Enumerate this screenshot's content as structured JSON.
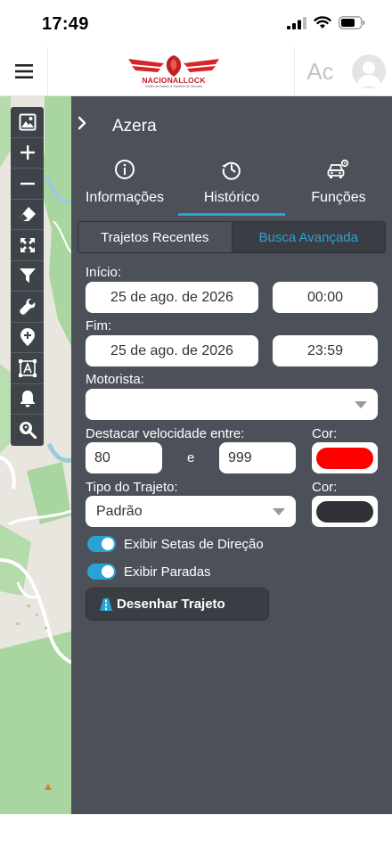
{
  "status_bar": {
    "time": "17:49"
  },
  "header": {
    "logo_text": "NACIONALLOCK",
    "logo_subtitle": "Centro de Rastro & Rastreio de Veículos",
    "user_initials": "Ac"
  },
  "panel": {
    "vehicle_name": "Azera",
    "tabs": [
      {
        "label": "Informações",
        "icon": "info-icon"
      },
      {
        "label": "Histórico",
        "icon": "history-icon",
        "active": true
      },
      {
        "label": "Funções",
        "icon": "car-gear-icon"
      }
    ],
    "segments": {
      "recent": "Trajetos Recentes",
      "advanced": "Busca Avançada",
      "active": "advanced"
    },
    "form": {
      "start_label": "Início:",
      "start_date": "25 de ago. de 2026",
      "start_time": "00:00",
      "end_label": "Fim:",
      "end_date": "25 de ago. de 2026",
      "end_time": "23:59",
      "driver_label": "Motorista:",
      "driver_value": "",
      "speed_label": "Destacar velocidade entre:",
      "speed_min": "80",
      "speed_sep": "e",
      "speed_max": "999",
      "color_label_1": "Cor:",
      "speed_color": "#ff0000",
      "route_type_label": "Tipo do Trajeto:",
      "route_type_value": "Padrão",
      "color_label_2": "Cor:",
      "route_color": "#2f3137",
      "toggle_arrows_label": "Exibir Setas de Direção",
      "toggle_arrows_on": true,
      "toggle_stops_label": "Exibir Paradas",
      "toggle_stops_on": true,
      "draw_button": "Desenhar Trajeto"
    }
  },
  "map_tools": [
    "image-icon",
    "zoom-in-icon",
    "zoom-out-icon",
    "eraser-icon",
    "fullscreen-icon",
    "filter-icon",
    "wrench-icon",
    "location-pin-icon",
    "text-frame-icon",
    "bell-icon",
    "search-location-icon"
  ],
  "colors": {
    "panel_bg": "#4c5059",
    "accent": "#2aa3d4",
    "map_bg": "#e9e6df"
  }
}
